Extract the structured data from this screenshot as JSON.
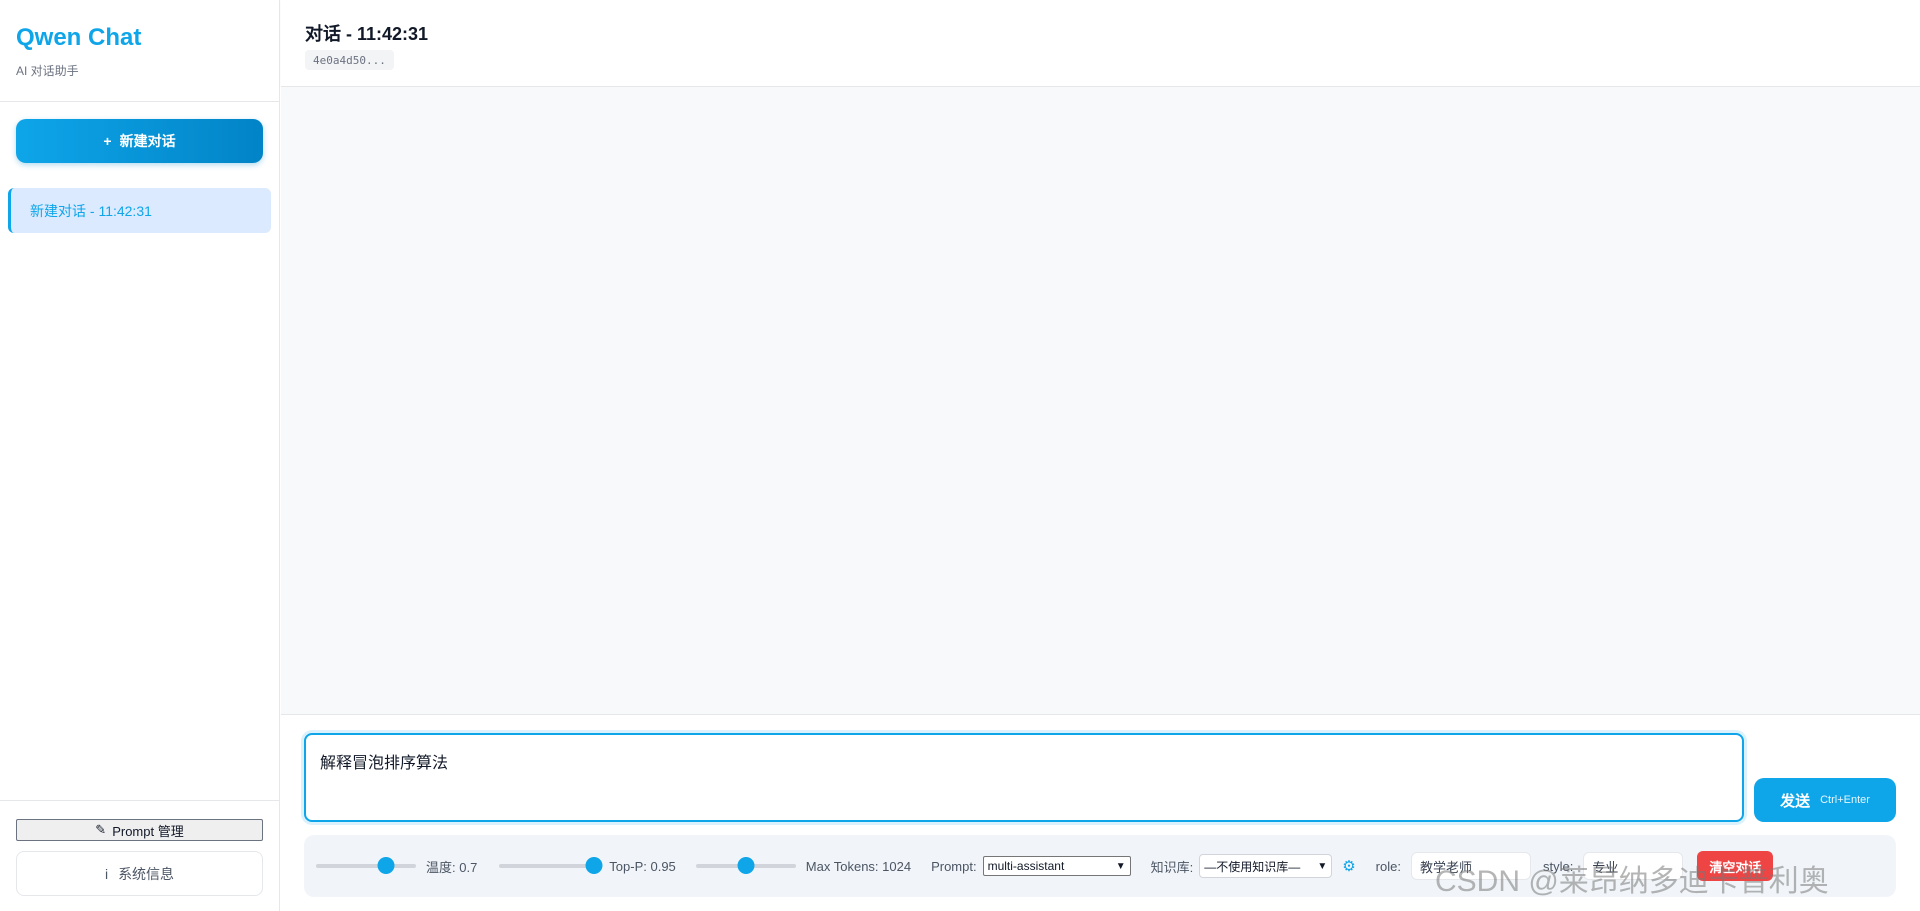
{
  "sidebar": {
    "brand_title": "Qwen Chat",
    "brand_subtitle": "AI 对话助手",
    "new_chat_label": "新建对话",
    "new_chat_icon": "+",
    "conversations": [
      {
        "label": "新建对话 - 11:42:31",
        "active": true
      }
    ],
    "prompt_manager_label": "Prompt 管理",
    "prompt_manager_icon": "✎",
    "system_info_label": "系统信息",
    "system_info_icon": "i"
  },
  "header": {
    "title": "对话 - 11:42:31",
    "conversation_id": "4e0a4d50..."
  },
  "input": {
    "value": "解释冒泡排序算法",
    "send_label": "发送",
    "send_hint": "Ctrl+Enter"
  },
  "controls": {
    "temperature": {
      "label": "温度: 0.7",
      "value": 0.7,
      "min": 0,
      "max": 1
    },
    "top_p": {
      "label": "Top-P: 0.95",
      "value": 0.95,
      "min": 0,
      "max": 1
    },
    "max_tokens": {
      "label": "Max Tokens: 1024",
      "value": 1024,
      "min": 0,
      "max": 2048
    },
    "prompt_label": "Prompt:",
    "prompt_selected": "multi-assistant",
    "kb_label": "知识库:",
    "kb_selected": "—不使用知识库—",
    "kb_settings_icon": "⚙",
    "role_label": "role:",
    "role_value": "教学老师",
    "style_label": "style:",
    "style_value": "专业",
    "clear_label": "清空对话"
  },
  "watermark": "CSDN @莱昂纳多迪卡普利奥",
  "colors": {
    "accent": "#0ea5e9",
    "active_bg": "#dbeafe",
    "danger": "#ef4444",
    "canvas": "#f8f9fb"
  }
}
